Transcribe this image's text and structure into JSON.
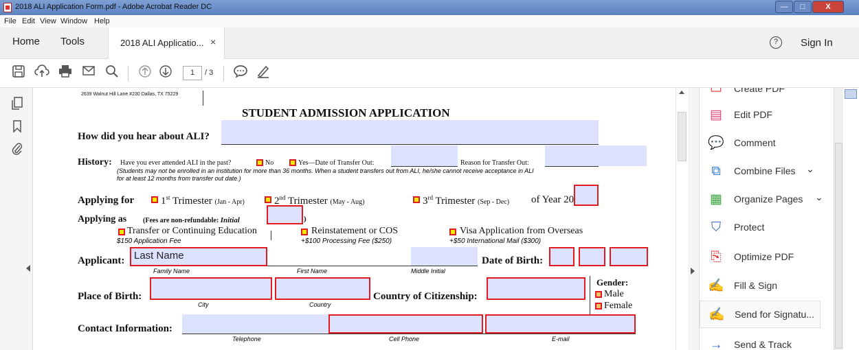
{
  "window": {
    "title": "2018 ALI Application Form.pdf - Adobe Acrobat Reader DC",
    "minimize": "—",
    "maximize": "□",
    "close": "X"
  },
  "menu": [
    "File",
    "Edit",
    "View",
    "Window",
    "Help"
  ],
  "tabs": {
    "home": "Home",
    "tools": "Tools",
    "document": "2018 ALI Applicatio...",
    "close": "×",
    "help": "?",
    "sign_in": "Sign In"
  },
  "toolbar": {
    "page_current": "1",
    "page_total": "/ 3"
  },
  "icons": {
    "save": "💾",
    "upload": "⇪",
    "print": "🖶",
    "email": "✉",
    "search": "🔍",
    "page_up": "⇧",
    "page_down": "⇩",
    "comment": "💬",
    "pen": "✎",
    "pages": "❐",
    "bookmark": "🔖",
    "paperclip": "📎"
  },
  "right_panel": {
    "items": [
      {
        "label": "Create PDF",
        "icon": "▭",
        "color": "#e03030"
      },
      {
        "label": "Edit PDF",
        "icon": "▤",
        "color": "#e0407a"
      },
      {
        "label": "Comment",
        "icon": "💬",
        "color": "#f0b400"
      },
      {
        "label": "Combine Files",
        "icon": "⧉",
        "color": "#3a7bd5",
        "chevron": "⌄"
      },
      {
        "label": "Organize Pages",
        "icon": "▦",
        "color": "#3aa640",
        "chevron": "⌄"
      },
      {
        "label": "Protect",
        "icon": "⛉",
        "color": "#3a66c5"
      },
      {
        "label": "Optimize PDF",
        "icon": "⎘",
        "color": "#e03030"
      },
      {
        "label": "Fill & Sign",
        "icon": "✍",
        "color": "#4a4aa0"
      },
      {
        "label": "Send for Signatu...",
        "icon": "✍",
        "color": "#3a66c5"
      },
      {
        "label": "Send & Track",
        "icon": "→",
        "color": "#3a66c5"
      }
    ]
  },
  "document": {
    "address": "2639 Walnut Hill Lane #230 Dallas, TX 75229",
    "title": "STUDENT ADMISSION APPLICATION",
    "hear_about": "How did you hear about ALI?",
    "history_label": "History:",
    "history_q": "Have you ever attended ALI in the past?",
    "no": "No",
    "yes": "Yes—Date of Transfer Out:",
    "reason": "Reason for Transfer Out:",
    "history_note1": "(Students may not be enrolled in an institution for more than 36 months.  When a student transfers out from ALI, he/she cannot receive acceptance in ALI",
    "history_note2": "for at least 12 months from transfer out date.)",
    "applying_for": "Applying for",
    "t1": "1",
    "t1_sup": "st",
    "t1_rest": " Trimester",
    "t1_dates": "(Jan - Apr)",
    "t2": "2",
    "t2_sup": "nd",
    "t2_rest": " Trimester",
    "t2_dates": "(May - Aug)",
    "t3": "3",
    "t3_sup": "rd",
    "t3_rest": " Trimester",
    "t3_dates": "(Sep - Dec)",
    "of_year": "of Year 20",
    "applying_as": "Applying as",
    "fees_note": "(Fees are non-refundable:",
    "initial": "Initial",
    "paren_close": ")",
    "opt_transfer": "Transfer or Continuing Education",
    "opt_transfer_fee": "$150 Application Fee",
    "opt_reinstate": "Reinstatement or COS",
    "opt_reinstate_fee": "+$100 Processing Fee ($250)",
    "opt_visa": "Visa Application from Overseas",
    "opt_visa_fee": "+$50 International Mail ($300)",
    "applicant": "Applicant:",
    "last_name": "Last Name",
    "family_name": "Family Name",
    "first_name": "First Name",
    "middle_initial": "Middle Initial",
    "dob": "Date of Birth:",
    "place_of_birth": "Place of Birth:",
    "city": "City",
    "country": "Country",
    "citizenship": "Country of Citizenship:",
    "gender": "Gender:",
    "male": "Male",
    "female": "Female",
    "contact": "Contact Information:",
    "telephone": "Telephone",
    "cell": "Cell Phone",
    "email": "E-mail"
  }
}
